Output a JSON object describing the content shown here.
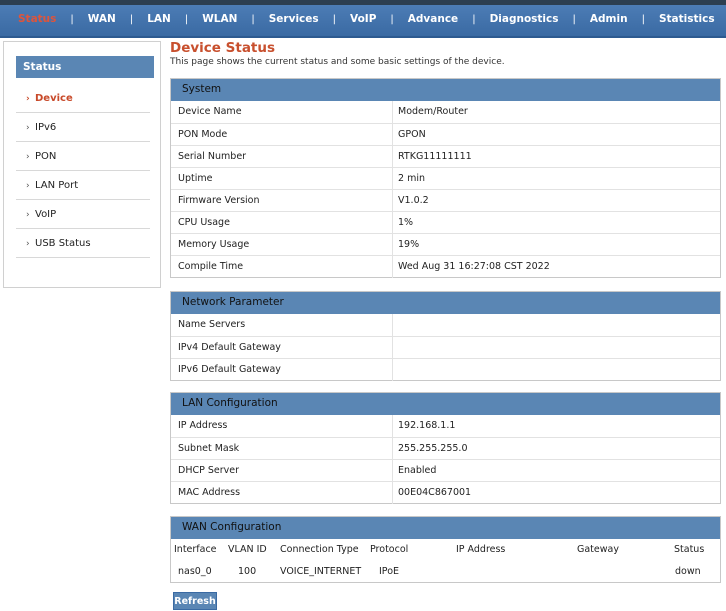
{
  "nav": {
    "items": [
      "Status",
      "WAN",
      "LAN",
      "WLAN",
      "Services",
      "VoIP",
      "Advance",
      "Diagnostics",
      "Admin",
      "Statistics"
    ],
    "active": "Status"
  },
  "sidebar": {
    "header": "Status",
    "items": [
      {
        "label": "Device",
        "active": true
      },
      {
        "label": "IPv6",
        "active": false
      },
      {
        "label": "PON",
        "active": false
      },
      {
        "label": "LAN Port",
        "active": false
      },
      {
        "label": "VoIP",
        "active": false
      },
      {
        "label": "USB Status",
        "active": false
      }
    ]
  },
  "page": {
    "title": "Device Status",
    "subtitle": "This page shows the current status and some basic settings of the device."
  },
  "system": {
    "header": "System",
    "rows": [
      {
        "k": "Device Name",
        "v": "Modem/Router"
      },
      {
        "k": "PON Mode",
        "v": "GPON"
      },
      {
        "k": "Serial Number",
        "v": "RTKG11111111"
      },
      {
        "k": "Uptime",
        "v": "2 min"
      },
      {
        "k": "Firmware Version",
        "v": "V1.0.2"
      },
      {
        "k": "CPU Usage",
        "v": "1%"
      },
      {
        "k": "Memory Usage",
        "v": "19%"
      },
      {
        "k": "Compile Time",
        "v": "Wed Aug 31 16:27:08 CST 2022"
      }
    ]
  },
  "network": {
    "header": "Network  Parameter",
    "rows": [
      {
        "k": "Name Servers",
        "v": ""
      },
      {
        "k": "IPv4 Default Gateway",
        "v": ""
      },
      {
        "k": "IPv6 Default Gateway",
        "v": ""
      }
    ]
  },
  "lan": {
    "header": "LAN Configuration",
    "rows": [
      {
        "k": "IP Address",
        "v": "192.168.1.1"
      },
      {
        "k": "Subnet Mask",
        "v": "255.255.255.0"
      },
      {
        "k": "DHCP Server",
        "v": "Enabled"
      },
      {
        "k": "MAC Address",
        "v": "00E04C867001"
      }
    ]
  },
  "wan": {
    "header": "WAN Configuration",
    "columns": [
      "Interface",
      "VLAN ID",
      "Connection Type",
      "Protocol",
      "IP Address",
      "Gateway",
      "Status"
    ],
    "rows": [
      [
        "nas0_0",
        "100",
        "VOICE_INTERNET",
        "IPoE",
        "",
        "",
        "down"
      ]
    ]
  },
  "buttons": {
    "refresh": "Refresh"
  }
}
